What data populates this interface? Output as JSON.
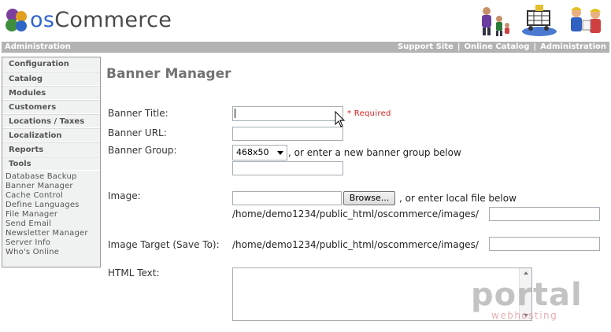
{
  "header": {
    "logo": {
      "part1": "os",
      "part2": "Commerce",
      "os_color": "#3366cc"
    },
    "images": [
      "family-icon",
      "shopping-cart-icon",
      "workers-icon"
    ]
  },
  "adminbar": {
    "left": "Administration",
    "links": [
      "Support Site",
      "Online Catalog",
      "Administration"
    ],
    "separator": "|",
    "bg": "#b3b3b3"
  },
  "sidebar": {
    "sections": [
      "Configuration",
      "Catalog",
      "Modules",
      "Customers",
      "Locations / Taxes",
      "Localization",
      "Reports",
      "Tools"
    ],
    "tools_links": [
      "Database Backup",
      "Banner Manager",
      "Cache Control",
      "Define Languages",
      "File Manager",
      "Send Email",
      "Newsletter Manager",
      "Server Info",
      "Who's Online"
    ]
  },
  "main": {
    "title": "Banner Manager",
    "banner_title_label": "Banner Title:",
    "required_text": "* Required",
    "banner_url_label": "Banner URL:",
    "banner_group_label": "Banner Group:",
    "banner_group_selected": "468x50",
    "banner_group_hint": ", or enter a new banner group below",
    "image_label": "Image:",
    "browse_label": "Browse...",
    "image_hint": ", or enter local file below",
    "image_path": "/home/demo1234/public_html/oscommerce/images/",
    "image_target_label": "Image Target (Save To):",
    "image_target_path": "/home/demo1234/public_html/oscommerce/images/",
    "html_text_label": "HTML Text:"
  },
  "watermark": {
    "big": "portal",
    "small": "webhosting"
  }
}
